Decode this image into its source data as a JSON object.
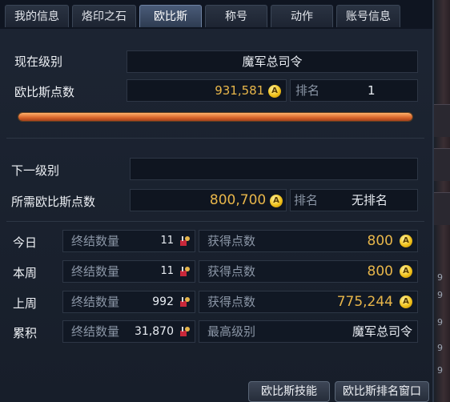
{
  "tabs": [
    "我的信息",
    "烙印之石",
    "欧比斯",
    "称号",
    "动作",
    "账号信息"
  ],
  "active_tab": "欧比斯",
  "current": {
    "level_label": "现在级别",
    "level_value": "魔军总司令",
    "points_label": "欧比斯点数",
    "points_value": "931,581",
    "rank_label": "排名",
    "rank_value": "1",
    "progress_pct": 100
  },
  "next": {
    "level_label": "下一级别",
    "level_value": "",
    "points_label": "所需欧比斯点数",
    "points_value": "800,700",
    "rank_label": "排名",
    "rank_value": "无排名"
  },
  "stats": [
    {
      "period": "今日",
      "kill_label": "终结数量",
      "kill_value": "11",
      "points_label": "获得点数",
      "points_value": "800"
    },
    {
      "period": "本周",
      "kill_label": "终结数量",
      "kill_value": "11",
      "points_label": "获得点数",
      "points_value": "800"
    },
    {
      "period": "上周",
      "kill_label": "终结数量",
      "kill_value": "992",
      "points_label": "获得点数",
      "points_value": "775,244"
    },
    {
      "period": "累积",
      "kill_label": "终结数量",
      "kill_value": "31,870",
      "points_label": "最高级别",
      "points_value": "魔军总司令"
    }
  ],
  "coin_glyph": "A",
  "buttons": {
    "skills": "欧比斯技能",
    "ranking": "欧比斯排名窗口"
  },
  "side_numbers": [
    "9",
    "9",
    "9",
    "9",
    "9"
  ],
  "colors": {
    "gold": "#e8b64a",
    "bar": "#d8642a"
  }
}
